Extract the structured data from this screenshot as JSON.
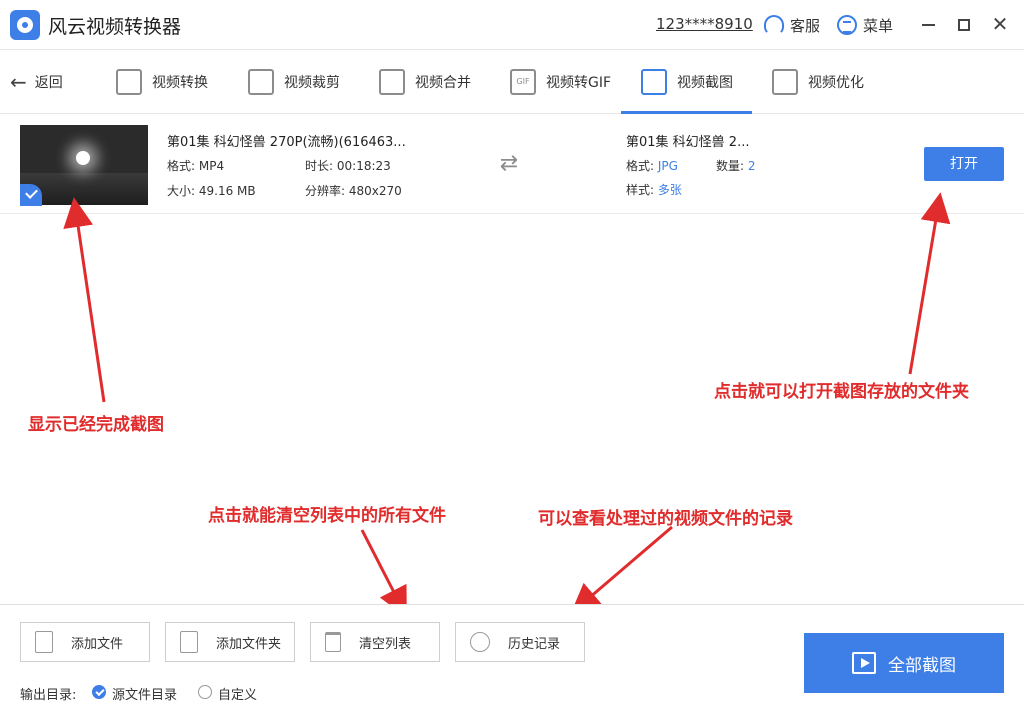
{
  "app": {
    "title": "风云视频转换器",
    "user_id": "123****8910",
    "support_label": "客服",
    "menu_label": "菜单"
  },
  "window_controls": {
    "close": "✕"
  },
  "toolbar": {
    "back_label": "返回",
    "tabs": [
      {
        "label": "视频转换",
        "icon": "video-convert-icon"
      },
      {
        "label": "视频裁剪",
        "icon": "video-crop-icon"
      },
      {
        "label": "视频合并",
        "icon": "video-merge-icon"
      },
      {
        "label": "视频转GIF",
        "icon": "gif-icon"
      },
      {
        "label": "视频截图",
        "icon": "screenshot-icon",
        "active": true
      },
      {
        "label": "视频优化",
        "icon": "equalizer-icon"
      }
    ],
    "gif_badge": "GIF"
  },
  "file": {
    "name": "第01集 科幻怪兽 270P(流畅)(616463...",
    "format_label": "格式:",
    "format": "MP4",
    "duration_label": "时长:",
    "duration": "00:18:23",
    "size_label": "大小:",
    "size": "49.16 MB",
    "resolution_label": "分辨率:",
    "resolution": "480x270"
  },
  "output": {
    "name": "第01集 科幻怪兽 2...",
    "format_label": "格式:",
    "format": "JPG",
    "count_label": "数量:",
    "count": "2",
    "style_label": "样式:",
    "style": "多张",
    "open_label": "打开"
  },
  "annotations": {
    "done": "显示已经完成截图",
    "open_folder": "点击就可以打开截图存放的文件夹",
    "clear": "点击就能清空列表中的所有文件",
    "history": "可以查看处理过的视频文件的记录"
  },
  "bottom": {
    "add_file": "添加文件",
    "add_folder": "添加文件夹",
    "clear_list": "清空列表",
    "history": "历史记录",
    "output_dir_label": "输出目录:",
    "source_dir": "源文件目录",
    "custom": "自定义",
    "capture_all": "全部截图"
  },
  "colors": {
    "accent": "#3d7fe6",
    "annotation": "#e02c2c"
  }
}
